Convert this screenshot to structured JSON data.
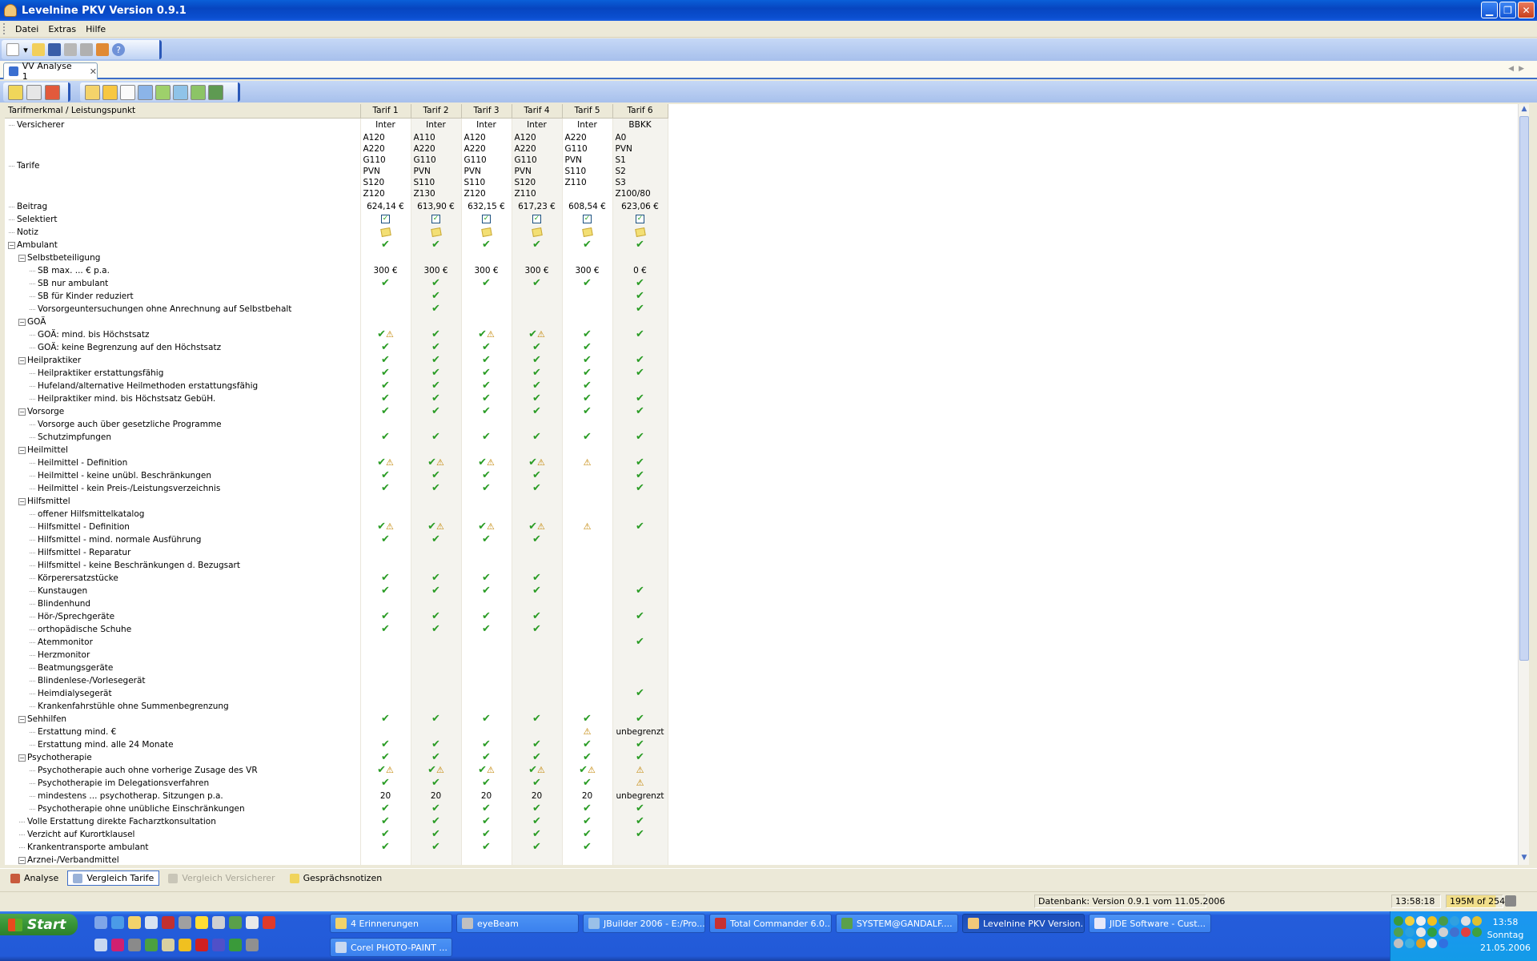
{
  "window": {
    "title": "Levelnine PKV Version 0.9.1"
  },
  "menu": [
    "Datei",
    "Extras",
    "Hilfe"
  ],
  "doc_tab": {
    "label": "VV Analyse 1"
  },
  "grid": {
    "header_label": "Tarifmerkmal / Leistungspunkt",
    "columns": [
      "Tarif 1",
      "Tarif 2",
      "Tarif 3",
      "Tarif 4",
      "Tarif 5",
      "Tarif 6"
    ],
    "rows": [
      {
        "label": "Versicherer",
        "level": 1,
        "toggle": "",
        "cells": [
          "Inter",
          "Inter",
          "Inter",
          "Inter",
          "Inter",
          "BBKK"
        ]
      },
      {
        "label": "Tarife",
        "level": 1,
        "toggle": "",
        "multi": true,
        "cells": [
          [
            "A120",
            "A220",
            "G110",
            "PVN",
            "S120",
            "Z120"
          ],
          [
            "A110",
            "A220",
            "G110",
            "PVN",
            "S110",
            "Z130"
          ],
          [
            "A120",
            "A220",
            "G110",
            "PVN",
            "S110",
            "Z120"
          ],
          [
            "A120",
            "A220",
            "G110",
            "PVN",
            "S120",
            "Z110"
          ],
          [
            "A220",
            "G110",
            "PVN",
            "S110",
            "Z110"
          ],
          [
            "A0",
            "PVN",
            "S1",
            "S2",
            "S3",
            "Z100/80"
          ]
        ]
      },
      {
        "label": "Beitrag",
        "level": 1,
        "toggle": "",
        "cells": [
          "624,14 €",
          "613,90 €",
          "632,15 €",
          "617,23 €",
          "608,54 €",
          "623,06 €"
        ]
      },
      {
        "label": "Selektiert",
        "level": 1,
        "toggle": "",
        "cells": [
          "CB",
          "CB",
          "CB",
          "CB",
          "CB",
          "CB"
        ]
      },
      {
        "label": "Notiz",
        "level": 1,
        "toggle": "",
        "cells": [
          "N",
          "N",
          "N",
          "N",
          "N",
          "N"
        ]
      },
      {
        "label": "Ambulant",
        "level": 1,
        "toggle": "−",
        "cells": [
          "C",
          "C",
          "C",
          "C",
          "C",
          "C"
        ]
      },
      {
        "label": "Selbstbeteiligung",
        "level": 2,
        "toggle": "−",
        "cells": [
          "",
          "",
          "",
          "",
          "",
          ""
        ]
      },
      {
        "label": "SB max. ... € p.a.",
        "level": 3,
        "toggle": "",
        "cells": [
          "300 €",
          "300 €",
          "300 €",
          "300 €",
          "300 €",
          "0 €"
        ]
      },
      {
        "label": "SB nur ambulant",
        "level": 3,
        "toggle": "",
        "cells": [
          "C",
          "C",
          "C",
          "C",
          "C",
          "C"
        ]
      },
      {
        "label": "SB für Kinder reduziert",
        "level": 3,
        "toggle": "",
        "cells": [
          "",
          "C",
          "",
          "",
          "",
          "C"
        ]
      },
      {
        "label": "Vorsorgeuntersuchungen ohne Anrechnung auf Selbstbehalt",
        "level": 3,
        "toggle": "",
        "cells": [
          "",
          "C",
          "",
          "",
          "",
          "C"
        ]
      },
      {
        "label": "GOÄ",
        "level": 2,
        "toggle": "−",
        "cells": [
          "",
          "",
          "",
          "",
          "",
          ""
        ]
      },
      {
        "label": "GOÄ: mind. bis Höchstsatz",
        "level": 3,
        "toggle": "",
        "cells": [
          "CW",
          "C",
          "CW",
          "CW",
          "C",
          "C"
        ]
      },
      {
        "label": "GOÄ: keine Begrenzung auf den Höchstsatz",
        "level": 3,
        "toggle": "",
        "cells": [
          "C",
          "C",
          "C",
          "C",
          "C",
          ""
        ]
      },
      {
        "label": "Heilpraktiker",
        "level": 2,
        "toggle": "−",
        "cells": [
          "C",
          "C",
          "C",
          "C",
          "C",
          "C"
        ]
      },
      {
        "label": "Heilpraktiker erstattungsfähig",
        "level": 3,
        "toggle": "",
        "cells": [
          "C",
          "C",
          "C",
          "C",
          "C",
          "C"
        ]
      },
      {
        "label": "Hufeland/alternative Heilmethoden erstattungsfähig",
        "level": 3,
        "toggle": "",
        "cells": [
          "C",
          "C",
          "C",
          "C",
          "C",
          ""
        ]
      },
      {
        "label": "Heilpraktiker mind. bis Höchstsatz GebüH.",
        "level": 3,
        "toggle": "",
        "cells": [
          "C",
          "C",
          "C",
          "C",
          "C",
          "C"
        ]
      },
      {
        "label": "Vorsorge",
        "level": 2,
        "toggle": "−",
        "cells": [
          "C",
          "C",
          "C",
          "C",
          "C",
          "C"
        ]
      },
      {
        "label": "Vorsorge auch über gesetzliche Programme",
        "level": 3,
        "toggle": "",
        "cells": [
          "",
          "",
          "",
          "",
          "",
          ""
        ]
      },
      {
        "label": "Schutzimpfungen",
        "level": 3,
        "toggle": "",
        "cells": [
          "C",
          "C",
          "C",
          "C",
          "C",
          "C"
        ]
      },
      {
        "label": "Heilmittel",
        "level": 2,
        "toggle": "−",
        "cells": [
          "",
          "",
          "",
          "",
          "",
          ""
        ]
      },
      {
        "label": "Heilmittel - Definition",
        "level": 3,
        "toggle": "",
        "cells": [
          "CW",
          "CW",
          "CW",
          "CW",
          "W",
          "C"
        ]
      },
      {
        "label": "Heilmittel - keine unübl. Beschränkungen",
        "level": 3,
        "toggle": "",
        "cells": [
          "C",
          "C",
          "C",
          "C",
          "",
          "C"
        ]
      },
      {
        "label": "Heilmittel - kein Preis-/Leistungsverzeichnis",
        "level": 3,
        "toggle": "",
        "cells": [
          "C",
          "C",
          "C",
          "C",
          "",
          "C"
        ]
      },
      {
        "label": "Hilfsmittel",
        "level": 2,
        "toggle": "−",
        "cells": [
          "",
          "",
          "",
          "",
          "",
          ""
        ]
      },
      {
        "label": "offener Hilfsmittelkatalog",
        "level": 3,
        "toggle": "",
        "cells": [
          "",
          "",
          "",
          "",
          "",
          ""
        ]
      },
      {
        "label": "Hilfsmittel - Definition",
        "level": 3,
        "toggle": "",
        "cells": [
          "CW",
          "CW",
          "CW",
          "CW",
          "W",
          "C"
        ]
      },
      {
        "label": "Hilfsmittel - mind. normale Ausführung",
        "level": 3,
        "toggle": "",
        "cells": [
          "C",
          "C",
          "C",
          "C",
          "",
          ""
        ]
      },
      {
        "label": "Hilfsmittel - Reparatur",
        "level": 3,
        "toggle": "",
        "cells": [
          "",
          "",
          "",
          "",
          "",
          ""
        ]
      },
      {
        "label": "Hilfsmittel - keine Beschränkungen d. Bezugsart",
        "level": 3,
        "toggle": "",
        "cells": [
          "",
          "",
          "",
          "",
          "",
          ""
        ]
      },
      {
        "label": "Körperersatzstücke",
        "level": 3,
        "toggle": "",
        "cells": [
          "C",
          "C",
          "C",
          "C",
          "",
          ""
        ]
      },
      {
        "label": "Kunstaugen",
        "level": 3,
        "toggle": "",
        "cells": [
          "C",
          "C",
          "C",
          "C",
          "",
          "C"
        ]
      },
      {
        "label": "Blindenhund",
        "level": 3,
        "toggle": "",
        "cells": [
          "",
          "",
          "",
          "",
          "",
          ""
        ]
      },
      {
        "label": "Hör-/Sprechgeräte",
        "level": 3,
        "toggle": "",
        "cells": [
          "C",
          "C",
          "C",
          "C",
          "",
          "C"
        ]
      },
      {
        "label": "orthopädische Schuhe",
        "level": 3,
        "toggle": "",
        "cells": [
          "C",
          "C",
          "C",
          "C",
          "",
          ""
        ]
      },
      {
        "label": "Atemmonitor",
        "level": 3,
        "toggle": "",
        "cells": [
          "",
          "",
          "",
          "",
          "",
          "C"
        ]
      },
      {
        "label": "Herzmonitor",
        "level": 3,
        "toggle": "",
        "cells": [
          "",
          "",
          "",
          "",
          "",
          ""
        ]
      },
      {
        "label": "Beatmungsgeräte",
        "level": 3,
        "toggle": "",
        "cells": [
          "",
          "",
          "",
          "",
          "",
          ""
        ]
      },
      {
        "label": "Blindenlese-/Vorlesegerät",
        "level": 3,
        "toggle": "",
        "cells": [
          "",
          "",
          "",
          "",
          "",
          ""
        ]
      },
      {
        "label": "Heimdialysegerät",
        "level": 3,
        "toggle": "",
        "cells": [
          "",
          "",
          "",
          "",
          "",
          "C"
        ]
      },
      {
        "label": "Krankenfahrstühle ohne Summenbegrenzung",
        "level": 3,
        "toggle": "",
        "cells": [
          "",
          "",
          "",
          "",
          "",
          ""
        ]
      },
      {
        "label": "Sehhilfen",
        "level": 2,
        "toggle": "−",
        "cells": [
          "C",
          "C",
          "C",
          "C",
          "C",
          "C"
        ]
      },
      {
        "label": "Erstattung mind. €",
        "level": 3,
        "toggle": "",
        "cells": [
          "",
          "",
          "",
          "",
          "W",
          "unbegrenzt"
        ]
      },
      {
        "label": "Erstattung mind. alle 24 Monate",
        "level": 3,
        "toggle": "",
        "cells": [
          "C",
          "C",
          "C",
          "C",
          "C",
          "C"
        ]
      },
      {
        "label": "Psychotherapie",
        "level": 2,
        "toggle": "−",
        "cells": [
          "C",
          "C",
          "C",
          "C",
          "C",
          "C"
        ]
      },
      {
        "label": "Psychotherapie auch ohne vorherige Zusage des VR",
        "level": 3,
        "toggle": "",
        "cells": [
          "CW",
          "CW",
          "CW",
          "CW",
          "CW",
          "W"
        ]
      },
      {
        "label": "Psychotherapie im Delegationsverfahren",
        "level": 3,
        "toggle": "",
        "cells": [
          "C",
          "C",
          "C",
          "C",
          "C",
          "W"
        ]
      },
      {
        "label": "mindestens ... psychotherap. Sitzungen p.a.",
        "level": 3,
        "toggle": "",
        "cells": [
          "20",
          "20",
          "20",
          "20",
          "20",
          "unbegrenzt"
        ]
      },
      {
        "label": "Psychotherapie ohne unübliche Einschränkungen",
        "level": 3,
        "toggle": "",
        "cells": [
          "C",
          "C",
          "C",
          "C",
          "C",
          "C"
        ]
      },
      {
        "label": "Volle Erstattung direkte Facharztkonsultation",
        "level": 2,
        "toggle": "",
        "cells": [
          "C",
          "C",
          "C",
          "C",
          "C",
          "C"
        ]
      },
      {
        "label": "Verzicht auf Kurortklausel",
        "level": 2,
        "toggle": "",
        "cells": [
          "C",
          "C",
          "C",
          "C",
          "C",
          "C"
        ]
      },
      {
        "label": "Krankentransporte ambulant",
        "level": 2,
        "toggle": "",
        "cells": [
          "C",
          "C",
          "C",
          "C",
          "C",
          ""
        ]
      },
      {
        "label": "Arznei-/Verbandmittel",
        "level": 2,
        "toggle": "−",
        "cells": [
          "",
          "",
          "",
          "",
          "",
          ""
        ]
      }
    ]
  },
  "bottom_tabs": [
    "Analyse",
    "Vergleich Tarife",
    "Vergleich Versicherer",
    "Gesprächsnotizen"
  ],
  "status": {
    "db": "Datenbank: Version 0.9.1 vom 11.05.2006",
    "time": "13:58:18",
    "memory": "195M of 254M"
  },
  "taskbar": {
    "start": "Start",
    "buttons": [
      "4 Erinnerungen",
      "eyeBeam",
      "JBuilder 2006 - E:/Pro...",
      "Total Commander 6.0...",
      "SYSTEM@GANDALF....",
      "Levelnine PKV Version...",
      "JIDE Software - Cust...",
      "Corel PHOTO-PAINT ..."
    ],
    "clock_time": "13:58",
    "clock_day": "Sonntag",
    "clock_date": "21.05.2006"
  }
}
